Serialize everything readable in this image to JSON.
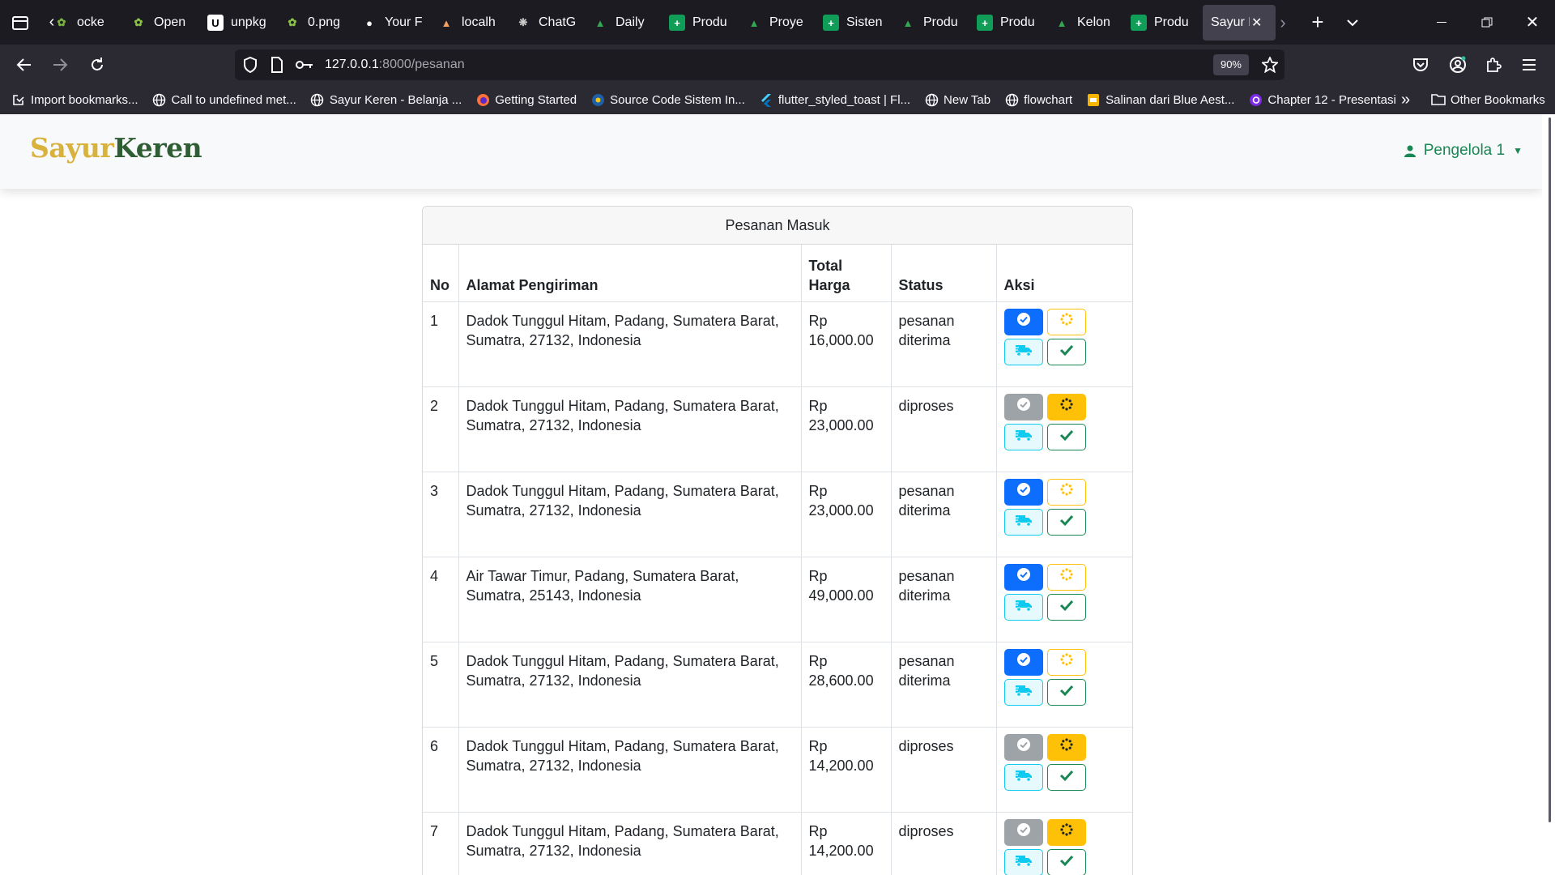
{
  "browser": {
    "tabs": [
      {
        "label": "ocke",
        "icon": "sheet-icon",
        "color": "#7cb342"
      },
      {
        "label": "Open",
        "icon": "sheet-icon",
        "color": "#8bc34a"
      },
      {
        "label": "unpkg",
        "icon": "unpkg-icon",
        "color": "#ffffff"
      },
      {
        "label": "0.png",
        "icon": "image-icon",
        "color": "#8bc34a"
      },
      {
        "label": "Your F",
        "icon": "github-icon",
        "color": "#ffffff"
      },
      {
        "label": "localh",
        "icon": "laravel-icon",
        "color": "#f4a261"
      },
      {
        "label": "ChatG",
        "icon": "chatgpt-icon",
        "color": "#cccccc"
      },
      {
        "label": "Daily",
        "icon": "drive-icon",
        "color": "#34a853"
      },
      {
        "label": "Produ",
        "icon": "sheets-icon",
        "color": "#0f9d58"
      },
      {
        "label": "Proye",
        "icon": "drive-icon",
        "color": "#34a853"
      },
      {
        "label": "Sisten",
        "icon": "sheets-icon",
        "color": "#0f9d58"
      },
      {
        "label": "Produ",
        "icon": "drive-icon",
        "color": "#34a853"
      },
      {
        "label": "Produ",
        "icon": "sheets-icon",
        "color": "#0f9d58"
      },
      {
        "label": "Kelon",
        "icon": "drive-icon",
        "color": "#34a853"
      },
      {
        "label": "Produ",
        "icon": "sheets-icon",
        "color": "#0f9d58"
      }
    ],
    "active_tab": {
      "label": "Sayur K"
    },
    "url": {
      "host": "127.0.0.1",
      "path": ":8000/pesanan"
    },
    "zoom": "90%",
    "bookmarks": [
      {
        "label": "Import bookmarks...",
        "icon": "import-icon"
      },
      {
        "label": "Call to undefined met...",
        "icon": "globe-icon"
      },
      {
        "label": "Sayur Keren - Belanja ...",
        "icon": "globe-icon"
      },
      {
        "label": "Getting Started",
        "icon": "firefox-icon"
      },
      {
        "label": "Source Code Sistem In...",
        "icon": "site-icon"
      },
      {
        "label": "flutter_styled_toast | Fl...",
        "icon": "flutter-icon"
      },
      {
        "label": "New Tab",
        "icon": "globe-icon"
      },
      {
        "label": "flowchart",
        "icon": "globe-icon"
      },
      {
        "label": "Salinan dari Blue Aest...",
        "icon": "slides-icon"
      },
      {
        "label": "Chapter 12 - Presentasi",
        "icon": "canva-icon"
      }
    ],
    "other_bookmarks": "Other Bookmarks"
  },
  "site": {
    "logo_part1": "Sayur",
    "logo_part2": "Keren",
    "user": "Pengelola 1"
  },
  "orders": {
    "title": "Pesanan Masuk",
    "columns": {
      "no": "No",
      "address": "Alamat Pengiriman",
      "total_line1": "Total",
      "total_line2": "Harga",
      "status": "Status",
      "actions": "Aksi"
    },
    "rows": [
      {
        "no": "1",
        "address": "Dadok Tunggul Hitam, Padang, Sumatera Barat, Sumatra, 27132, Indonesia",
        "currency": "Rp",
        "amount": "16,000.00",
        "status_line1": "pesanan",
        "status_line2": "diterima",
        "state": "diterima"
      },
      {
        "no": "2",
        "address": "Dadok Tunggul Hitam, Padang, Sumatera Barat, Sumatra, 27132, Indonesia",
        "currency": "Rp",
        "amount": "23,000.00",
        "status_line1": "diproses",
        "status_line2": "",
        "state": "diproses"
      },
      {
        "no": "3",
        "address": "Dadok Tunggul Hitam, Padang, Sumatera Barat, Sumatra, 27132, Indonesia",
        "currency": "Rp",
        "amount": "23,000.00",
        "status_line1": "pesanan",
        "status_line2": "diterima",
        "state": "diterima"
      },
      {
        "no": "4",
        "address": "Air Tawar Timur, Padang, Sumatera Barat, Sumatra, 25143, Indonesia",
        "currency": "Rp",
        "amount": "49,000.00",
        "status_line1": "pesanan",
        "status_line2": "diterima",
        "state": "diterima"
      },
      {
        "no": "5",
        "address": "Dadok Tunggul Hitam, Padang, Sumatera Barat, Sumatra, 27132, Indonesia",
        "currency": "Rp",
        "amount": "28,600.00",
        "status_line1": "pesanan",
        "status_line2": "diterima",
        "state": "diterima"
      },
      {
        "no": "6",
        "address": "Dadok Tunggul Hitam, Padang, Sumatera Barat, Sumatra, 27132, Indonesia",
        "currency": "Rp",
        "amount": "14,200.00",
        "status_line1": "diproses",
        "status_line2": "",
        "state": "diproses"
      },
      {
        "no": "7",
        "address": "Dadok Tunggul Hitam, Padang, Sumatera Barat, Sumatra, 27132, Indonesia",
        "currency": "Rp",
        "amount": "14,200.00",
        "status_line1": "diproses",
        "status_line2": "",
        "state": "diproses"
      }
    ]
  },
  "colors": {
    "confirm_active": "#0d6efd",
    "confirm_inactive": "#9ea3a8",
    "process": "#ffc107",
    "ship": "#0dcaf0",
    "done": "#198754",
    "logo_gold": "#d8b23c",
    "logo_green": "#2f5d34"
  }
}
